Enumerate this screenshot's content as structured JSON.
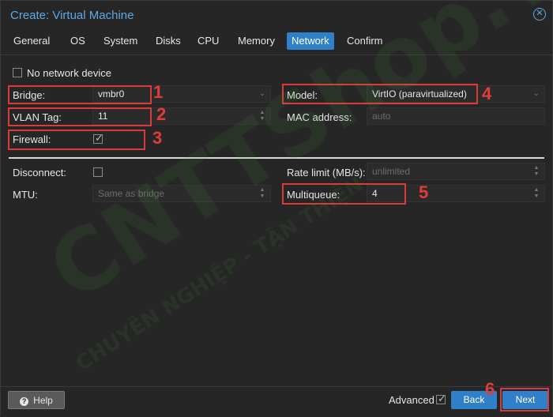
{
  "window": {
    "title": "Create: Virtual Machine"
  },
  "tabs": [
    {
      "label": "General"
    },
    {
      "label": "OS"
    },
    {
      "label": "System"
    },
    {
      "label": "Disks"
    },
    {
      "label": "CPU"
    },
    {
      "label": "Memory"
    },
    {
      "label": "Network"
    },
    {
      "label": "Confirm"
    }
  ],
  "active_tab": "Network",
  "form": {
    "no_network_label": "No network device",
    "bridge": {
      "label": "Bridge:",
      "value": "vmbr0"
    },
    "vlan": {
      "label": "VLAN Tag:",
      "value": "11"
    },
    "firewall": {
      "label": "Firewall:",
      "checked": true
    },
    "model": {
      "label": "Model:",
      "value": "VirtIO (paravirtualized)"
    },
    "mac": {
      "label": "MAC address:",
      "placeholder": "auto"
    },
    "disconnect": {
      "label": "Disconnect:",
      "checked": false
    },
    "mtu": {
      "label": "MTU:",
      "placeholder": "Same as bridge"
    },
    "rate_limit": {
      "label": "Rate limit (MB/s):",
      "placeholder": "unlimited"
    },
    "multiqueue": {
      "label": "Multiqueue:",
      "value": "4"
    }
  },
  "annotations": [
    "1",
    "2",
    "3",
    "4",
    "5",
    "6"
  ],
  "footer": {
    "help_label": "Help",
    "advanced_label": "Advanced",
    "advanced_checked": true,
    "back_label": "Back",
    "next_label": "Next"
  },
  "watermark": {
    "line1": "CNTTShop.vn",
    "line2": "CHUYÊN NGHIỆP - TẬN THIỆN"
  },
  "colors": {
    "accent": "#2f7fc9",
    "title": "#5fa9e6",
    "annotation": "#d93a3a",
    "background": "#262626"
  }
}
